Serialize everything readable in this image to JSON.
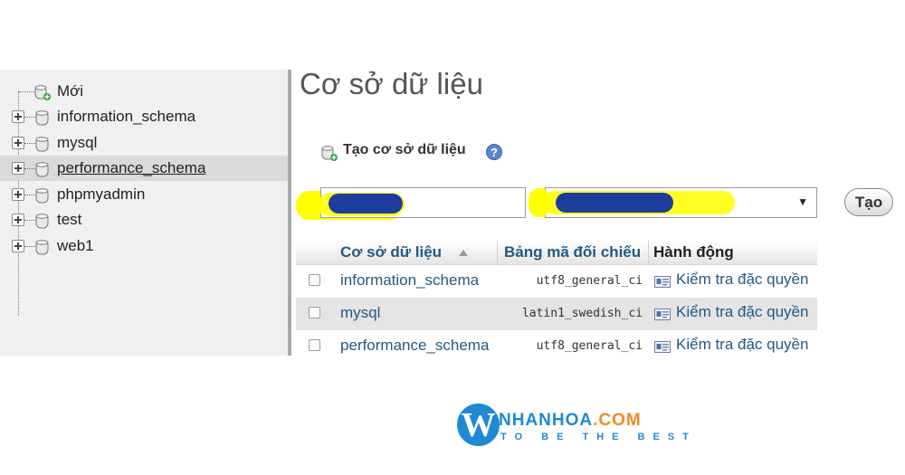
{
  "sidebar": {
    "items": [
      {
        "label": "Mới",
        "type": "new"
      },
      {
        "label": "information_schema",
        "type": "db"
      },
      {
        "label": "mysql",
        "type": "db"
      },
      {
        "label": "performance_schema",
        "type": "db",
        "active": true
      },
      {
        "label": "phpmyadmin",
        "type": "db"
      },
      {
        "label": "test",
        "type": "db"
      },
      {
        "label": "web1",
        "type": "db"
      }
    ]
  },
  "main": {
    "title": "Cơ sở dữ liệu",
    "create": {
      "label": "Tạo cơ sở dữ liệu",
      "help_icon": "?",
      "name_value": "",
      "collation_value": "",
      "button_label": "Tạo"
    },
    "table": {
      "headers": {
        "name": "Cơ sở dữ liệu",
        "collation": "Bảng mã đối chiếu",
        "action": "Hành động"
      },
      "rows": [
        {
          "name": "information_schema",
          "collation": "utf8_general_ci",
          "action": "Kiểm tra đặc quyền"
        },
        {
          "name": "mysql",
          "collation": "latin1_swedish_ci",
          "action": "Kiểm tra đặc quyền"
        },
        {
          "name": "performance_schema",
          "collation": "utf8_general_ci",
          "action": "Kiểm tra đặc quyền"
        }
      ]
    }
  },
  "logo": {
    "letter": "W",
    "name_main": "NHANHOA",
    "name_dot": ".",
    "name_tld": "COM",
    "tagline": "TO BE THE BEST"
  },
  "colors": {
    "link": "#235a81",
    "highlight": "#ffff00",
    "redaction": "#1d3d9c",
    "logo_blue": "#1f89d4",
    "logo_orange": "#f08a24"
  }
}
